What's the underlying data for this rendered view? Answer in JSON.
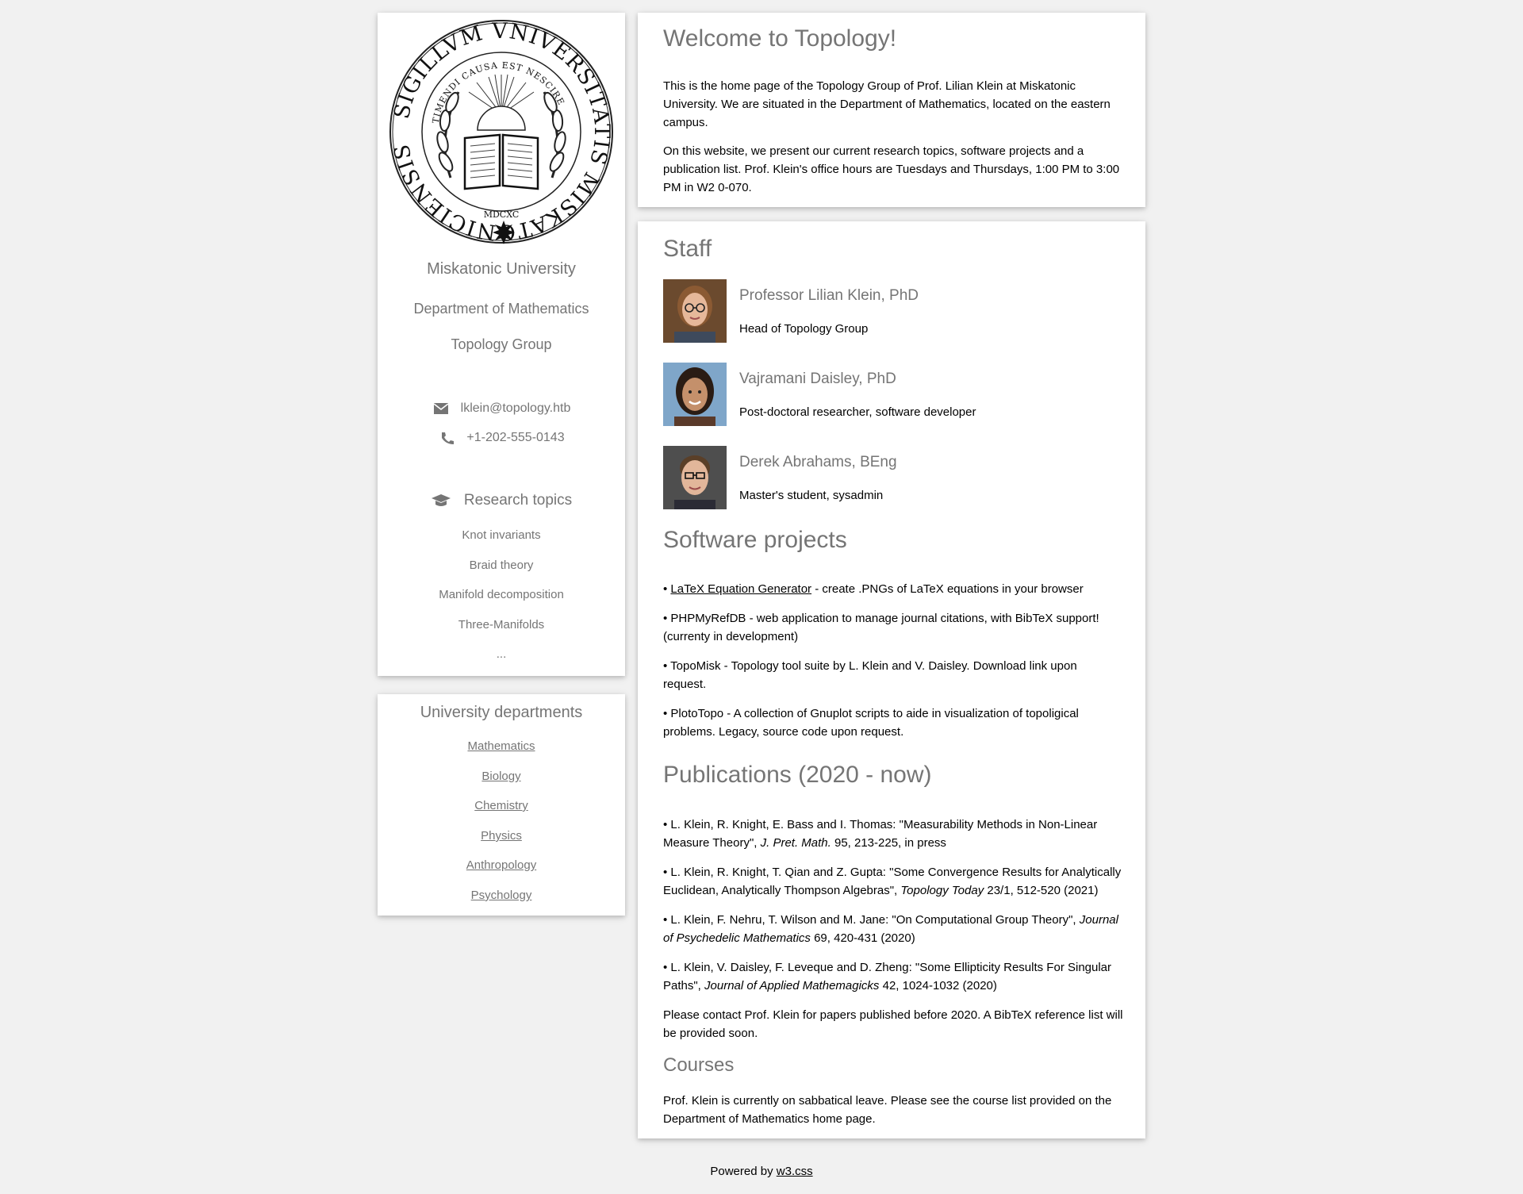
{
  "sidebar": {
    "seal": {
      "outer_text": "SIGILLVM VNIVERSITATIS MISKATONICIENSIS",
      "inner_text": "TIMENDI CAUSA EST NESCIRE",
      "year": "MDCXC"
    },
    "university": "Miskatonic University",
    "department": "Department of Mathematics",
    "group": "Topology Group",
    "email": "lklein@topology.htb",
    "phone": "+1-202-555-0143",
    "research_heading": "Research topics",
    "research_topics": [
      "Knot invariants",
      "Braid theory",
      "Manifold decomposition",
      "Three-Manifolds",
      "..."
    ],
    "icons": {
      "email": "envelope-icon",
      "phone": "phone-icon",
      "research": "graduation-cap-icon"
    }
  },
  "departments": {
    "heading": "University departments",
    "links": [
      "Mathematics",
      "Biology",
      "Chemistry",
      "Physics",
      "Anthropology",
      "Psychology"
    ]
  },
  "welcome": {
    "title": "Welcome to Topology!",
    "p1": "This is the home page of the Topology Group of Prof. Lilian Klein at Miskatonic University. We are situated in the Department of Mathematics, located on the eastern campus.",
    "p2": "On this website, we present our current research topics, software projects and a publication list. Prof. Klein's office hours are Tuesdays and Thursdays, 1:00 PM to 3:00 PM in W2 0-070."
  },
  "staff": {
    "heading": "Staff",
    "members": [
      {
        "name": "Professor Lilian Klein, PhD",
        "role": "Head of Topology Group"
      },
      {
        "name": "Vajramani Daisley, PhD",
        "role": "Post-doctoral researcher, software developer"
      },
      {
        "name": "Derek Abrahams, BEng",
        "role": "Master's student, sysadmin"
      }
    ]
  },
  "software": {
    "heading": "Software projects",
    "items": [
      {
        "bullet": "• ",
        "link": "LaTeX Equation Generator",
        "text": " - create .PNGs of LaTeX equations in your browser"
      },
      {
        "bullet": "• ",
        "text": "PHPMyRefDB - web application to manage journal citations, with BibTeX support! (currenty in development)"
      },
      {
        "bullet": "• ",
        "text": "TopoMisk - Topology tool suite by L. Klein and V. Daisley. Download link upon request."
      },
      {
        "bullet": "• ",
        "text": "PlotoTopo - A collection of Gnuplot scripts to aide in visualization of topoligical problems. Legacy, source code upon request."
      }
    ]
  },
  "publications": {
    "heading": "Publications (2020 - now)",
    "items": [
      {
        "pre": "• L. Klein, R. Knight, E. Bass and I. Thomas: \"Measurability Methods in Non-Linear Measure Theory\", ",
        "journal": "J. Pret. Math.",
        "post": " 95, 213-225, in press"
      },
      {
        "pre": "• L. Klein, R. Knight, T. Qian and Z. Gupta: \"Some Convergence Results for Analytically Euclidean, Analytically Thompson Algebras\", ",
        "journal": "Topology Today",
        "post": " 23/1, 512-520 (2021)"
      },
      {
        "pre": "• L. Klein, F. Nehru, T. Wilson and M. Jane: \"On Computational Group Theory\", ",
        "journal": "Journal of Psychedelic Mathematics",
        "post": " 69, 420-431 (2020)"
      },
      {
        "pre": "• L. Klein, V. Daisley, F. Leveque and D. Zheng: \"Some Ellipticity Results For Singular Paths\", ",
        "journal": "Journal of Applied Mathemagicks",
        "post": " 42, 1024-1032 (2020)"
      }
    ],
    "note": "Please contact Prof. Klein for papers published before 2020. A BibTeX reference list will be provided soon."
  },
  "courses": {
    "heading": "Courses",
    "text": "Prof. Klein is currently on sabbatical leave. Please see the course list provided on the Department of Mathematics home page."
  },
  "footer": {
    "prefix": "Powered by ",
    "link": "w3.css"
  }
}
